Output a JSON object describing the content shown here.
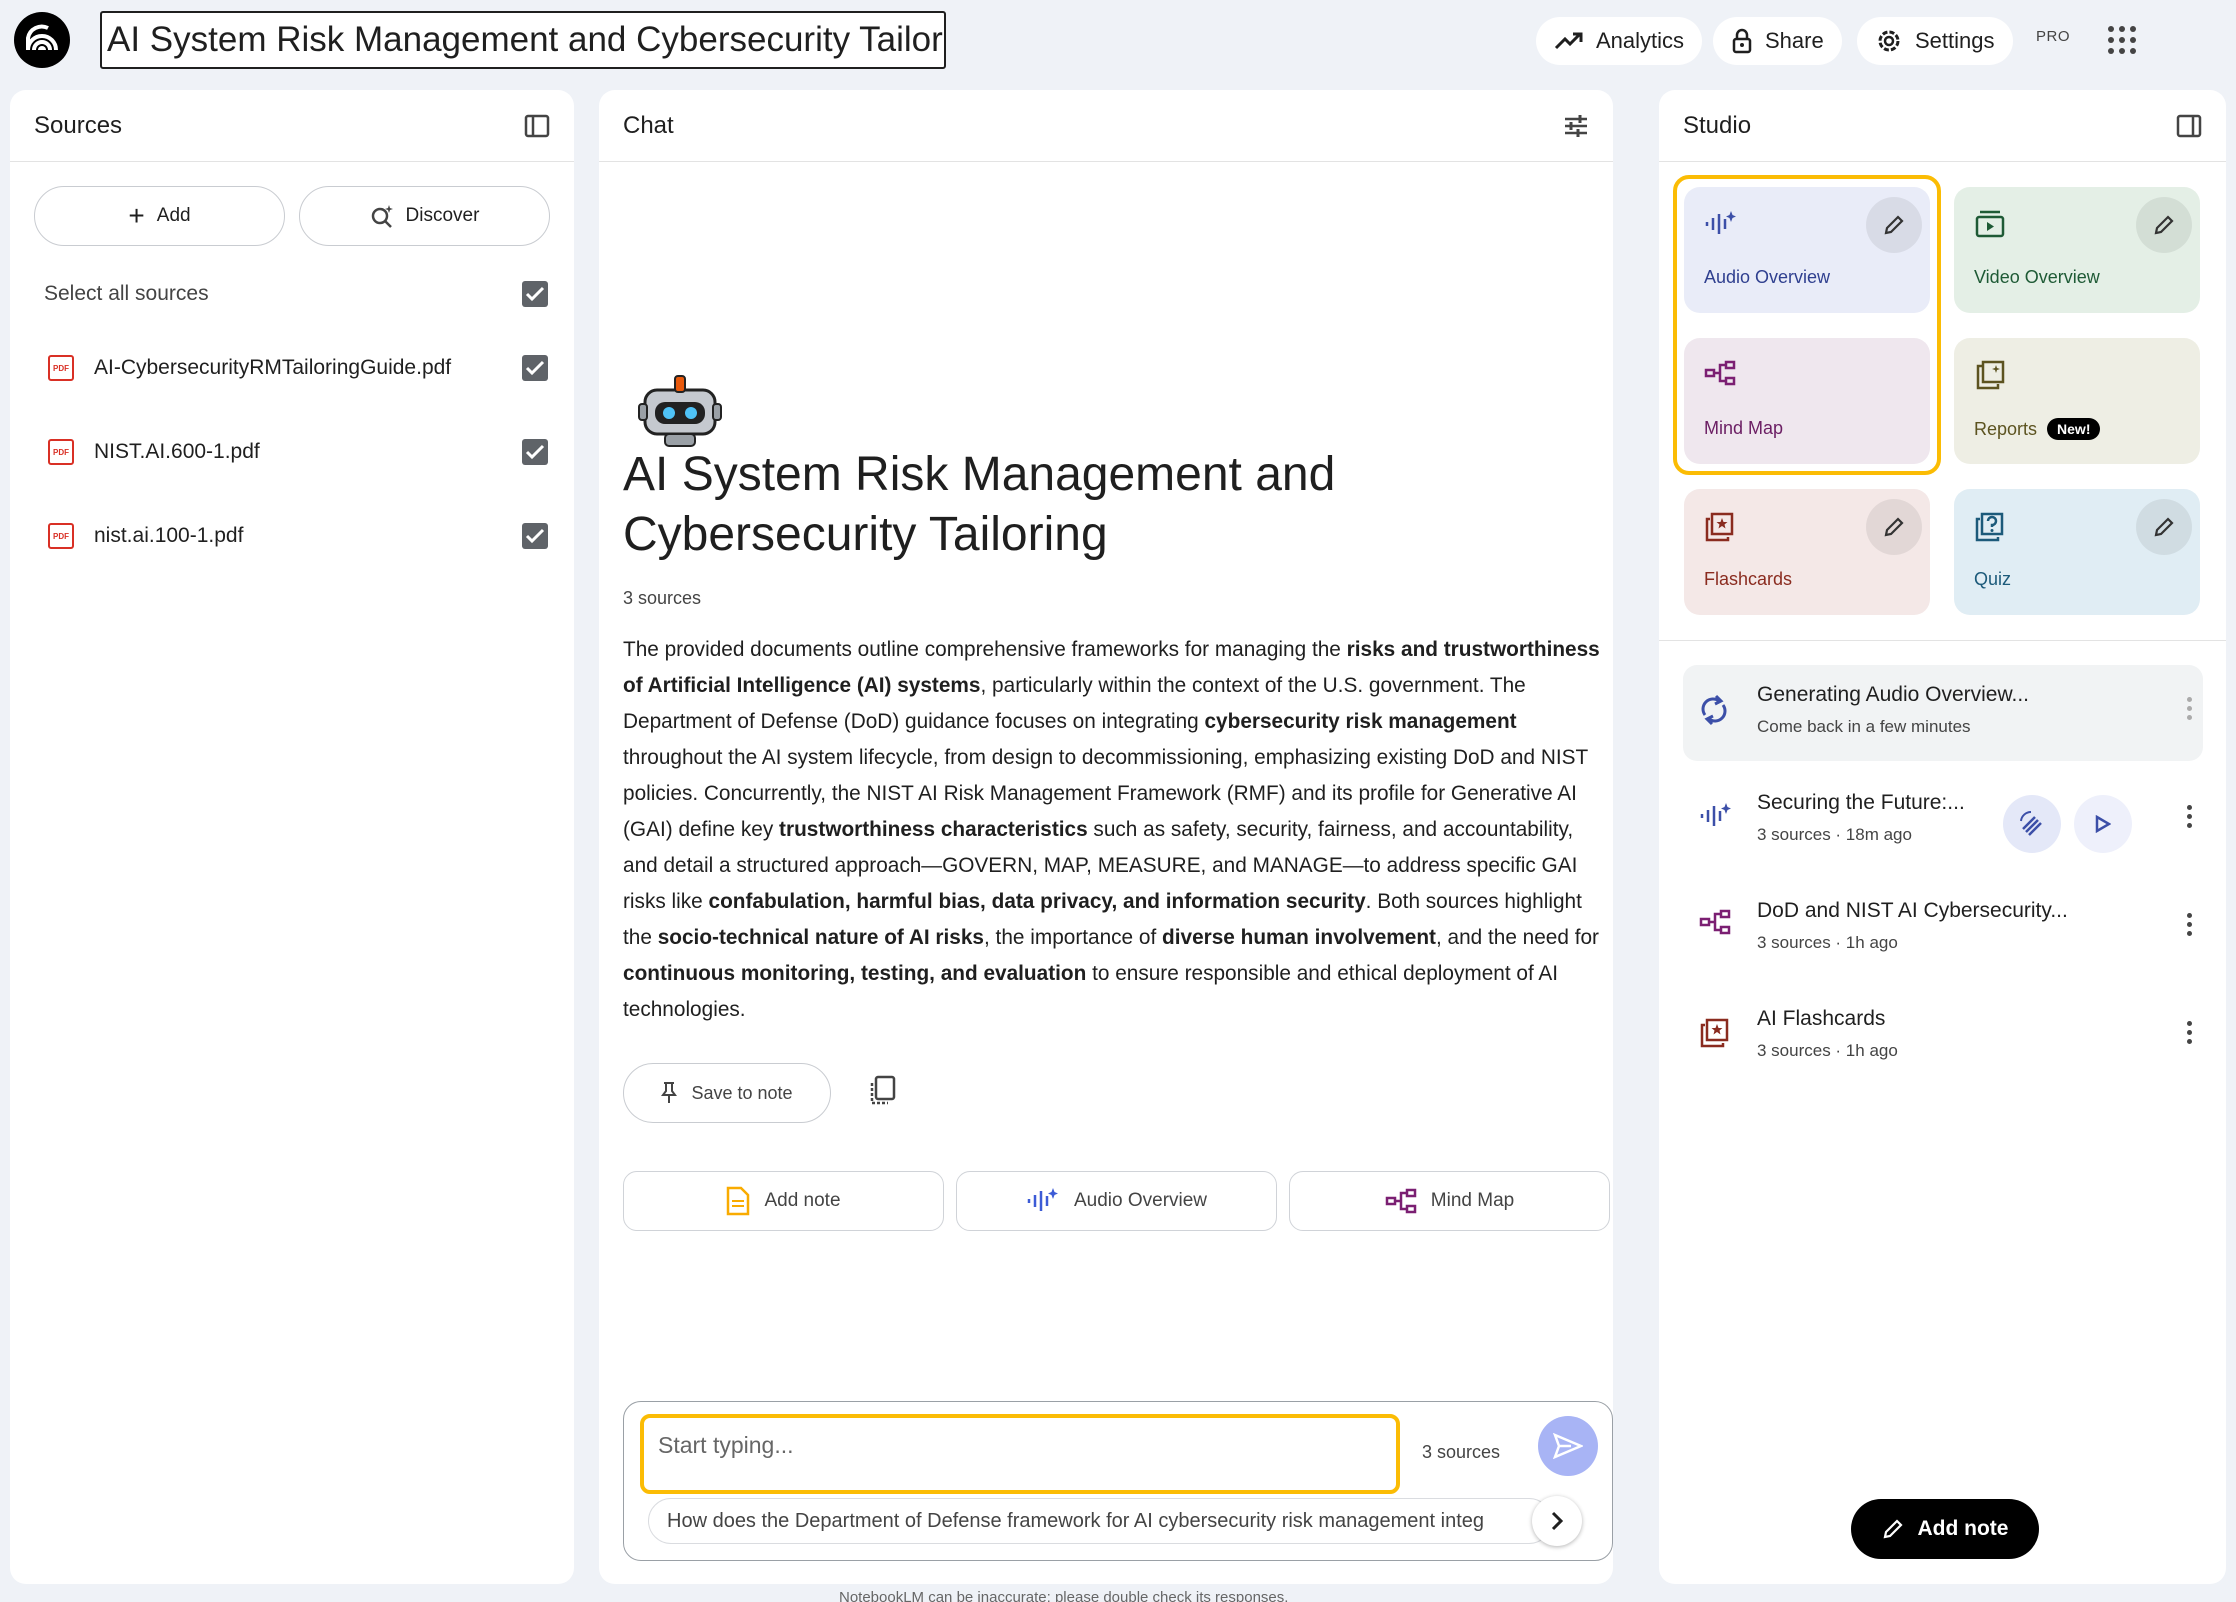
{
  "app": {
    "notebook_title": "AI System Risk Management and Cybersecurity Tailoring",
    "pro_badge": "PRO"
  },
  "topbar": {
    "analytics_label": "Analytics",
    "share_label": "Share",
    "settings_label": "Settings"
  },
  "sources": {
    "title": "Sources",
    "add_label": "Add",
    "discover_label": "Discover",
    "select_all_label": "Select all sources",
    "items": [
      {
        "name": "AI-CybersecurityRMTailoringGuide.pdf",
        "checked": true
      },
      {
        "name": "NIST.AI.600-1.pdf",
        "checked": true
      },
      {
        "name": "nist.ai.100-1.pdf",
        "checked": true
      }
    ]
  },
  "chat": {
    "title": "Chat",
    "notebook_heading": "AI System Risk Management and Cybersecurity Tailoring",
    "source_count": "3 sources",
    "summary_segments": [
      {
        "text": "The provided documents outline comprehensive frameworks for managing the ",
        "bold": false
      },
      {
        "text": "risks and trustworthiness of Artificial Intelligence (AI) systems",
        "bold": true
      },
      {
        "text": ", particularly within the context of the U.S. government. The Department of Defense (DoD) guidance focuses on integrating ",
        "bold": false
      },
      {
        "text": "cybersecurity risk management",
        "bold": true
      },
      {
        "text": " throughout the AI system lifecycle, from design to decommissioning, emphasizing existing DoD and NIST policies. Concurrently, the NIST AI Risk Management Framework (RMF) and its profile for Generative AI (GAI) define key ",
        "bold": false
      },
      {
        "text": "trustworthiness characteristics",
        "bold": true
      },
      {
        "text": " such as safety, security, fairness, and accountability, and detail a structured approach—GOVERN, MAP, MEASURE, and MANAGE—to address specific GAI risks like ",
        "bold": false
      },
      {
        "text": "confabulation, harmful bias, data privacy, and information security",
        "bold": true
      },
      {
        "text": ". Both sources highlight the ",
        "bold": false
      },
      {
        "text": "socio-technical nature of AI risks",
        "bold": true
      },
      {
        "text": ", the importance of ",
        "bold": false
      },
      {
        "text": "diverse human involvement",
        "bold": true
      },
      {
        "text": ", and the need for ",
        "bold": false
      },
      {
        "text": "continuous monitoring, testing, and evaluation",
        "bold": true
      },
      {
        "text": " to ensure responsible and ethical deployment of AI technologies.",
        "bold": false
      }
    ],
    "save_to_note_label": "Save to note",
    "suggestion_buttons": {
      "add_note": "Add note",
      "audio_overview": "Audio Overview",
      "mind_map": "Mind Map"
    },
    "composer": {
      "placeholder": "Start typing...",
      "source_count": "3 sources",
      "followup_question": "How does the Department of Defense framework for AI cybersecurity risk management integ"
    },
    "disclaimer": "NotebookLM can be inaccurate; please double check its responses."
  },
  "studio": {
    "title": "Studio",
    "tiles": {
      "audio_overview": "Audio Overview",
      "video_overview": "Video Overview",
      "mind_map": "Mind Map",
      "reports": "Reports",
      "reports_badge": "New!",
      "flashcards": "Flashcards",
      "quiz": "Quiz"
    },
    "artifacts": [
      {
        "title": "Generating Audio Overview...",
        "subtitle": "Come back in a few minutes",
        "icon": "sync-icon"
      },
      {
        "title": "Securing the Future:...",
        "subtitle": "3 sources · 18m ago",
        "icon": "audio-sparkle-icon"
      },
      {
        "title": "DoD and NIST AI Cybersecurity...",
        "subtitle": "3 sources · 1h ago",
        "icon": "mind-map-icon"
      },
      {
        "title": "AI Flashcards",
        "subtitle": "3 sources · 1h ago",
        "icon": "flashcards-icon"
      }
    ],
    "add_note_label": "Add note"
  },
  "colors": {
    "highlight": "#fbbc04",
    "audio_tile": "#e9ecf8",
    "video_tile": "#e4efe6",
    "mindmap_tile": "#efe7ee",
    "reports_tile": "#eeeee4",
    "flashcards_tile": "#f4e8e7",
    "quiz_tile": "#e0edf4"
  }
}
